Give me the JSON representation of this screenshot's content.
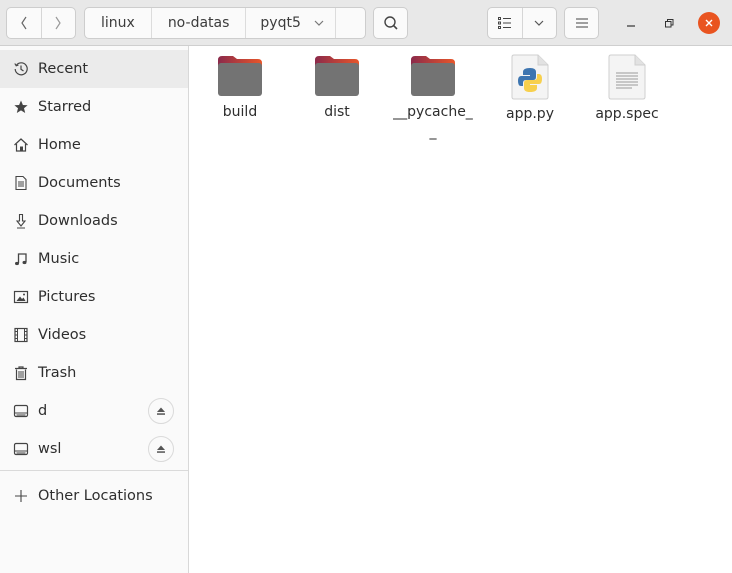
{
  "header": {
    "nav": {
      "back_icon": "chevron-left-icon",
      "forward_icon": "chevron-right-icon"
    },
    "path": [
      {
        "label": "linux"
      },
      {
        "label": "no-datas"
      },
      {
        "label": "pyqt5",
        "current": true
      }
    ],
    "path_menu_icon": "chevron-down-icon",
    "search_icon": "search-icon",
    "view_icon": "list-view-icon",
    "view_options_icon": "chevron-down-icon",
    "menu_icon": "hamburger-menu-icon",
    "window_controls": {
      "minimize": "minimize-icon",
      "maximize": "restore-icon",
      "close": "close-icon"
    },
    "accent_close": "#e95420"
  },
  "sidebar": {
    "items": [
      {
        "label": "Recent",
        "icon": "clock-icon",
        "active": true
      },
      {
        "label": "Starred",
        "icon": "star-icon"
      },
      {
        "label": "Home",
        "icon": "home-icon"
      },
      {
        "label": "Documents",
        "icon": "document-icon"
      },
      {
        "label": "Downloads",
        "icon": "download-icon"
      },
      {
        "label": "Music",
        "icon": "music-note-icon"
      },
      {
        "label": "Pictures",
        "icon": "picture-icon"
      },
      {
        "label": "Videos",
        "icon": "film-icon"
      },
      {
        "label": "Trash",
        "icon": "trash-icon"
      },
      {
        "label": "d",
        "icon": "drive-icon",
        "eject": true
      },
      {
        "label": "wsl",
        "icon": "drive-icon",
        "eject": true
      }
    ],
    "other_locations": {
      "label": "Other Locations",
      "icon": "plus-icon"
    }
  },
  "files": [
    {
      "name": "build",
      "type": "folder"
    },
    {
      "name": "dist",
      "type": "folder"
    },
    {
      "name": "__pycache__",
      "type": "folder"
    },
    {
      "name": "app.py",
      "type": "python"
    },
    {
      "name": "app.spec",
      "type": "text"
    }
  ]
}
